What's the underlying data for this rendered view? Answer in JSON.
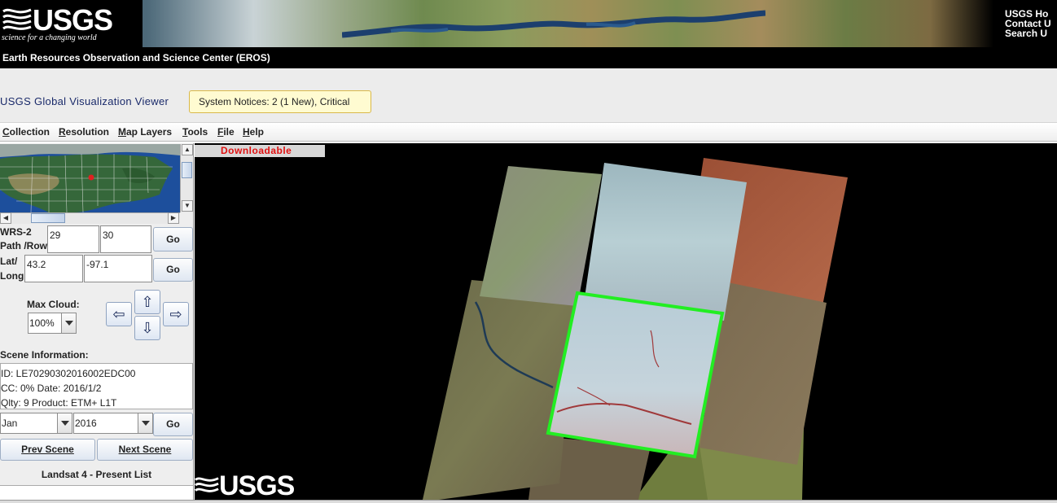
{
  "banner": {
    "logo_word": "USGS",
    "logo_tagline": "science for a changing world",
    "links": [
      "USGS Ho",
      "Contact U",
      "Search U"
    ]
  },
  "eros_bar": {
    "title": "Earth Resources Observation and Science Center (EROS)"
  },
  "header": {
    "app_title": "USGS Global Visualization Viewer",
    "system_notices": "System Notices: 2 (1 New), Critical"
  },
  "menu": {
    "items": [
      {
        "label": "Collection",
        "mnemonic": "C",
        "rest": "ollection"
      },
      {
        "label": "Resolution",
        "mnemonic": "R",
        "rest": "esolution"
      },
      {
        "label": "Map Layers",
        "mnemonic": "M",
        "rest": "ap Layers"
      },
      {
        "label": "Tools",
        "mnemonic": "T",
        "rest": "ools"
      },
      {
        "label": "File",
        "mnemonic": "F",
        "rest": "ile"
      },
      {
        "label": "Help",
        "mnemonic": "H",
        "rest": "elp"
      }
    ]
  },
  "left_panel": {
    "wrs": {
      "label_line1": "WRS-2",
      "label_line2": "Path /Row:",
      "path_value": "29",
      "row_value": "30",
      "go_label": "Go"
    },
    "latlong": {
      "label_line1": "Lat/",
      "label_line2": "Long:",
      "lat_value": "43.2",
      "long_value": "-97.1",
      "go_label": "Go"
    },
    "max_cloud": {
      "label": "Max Cloud:",
      "value": "100%"
    },
    "nav_arrows": {
      "up": "⇧",
      "down": "⇩",
      "left": "⇦",
      "right": "⇨"
    },
    "scene_info": {
      "heading": "Scene Information:",
      "id_line": "ID: LE70290302016002EDC00",
      "cc_date_line": "CC: 0%   Date: 2016/1/2",
      "qlty_product_line": "Qlty: 9  Product: ETM+ L1T"
    },
    "date_select": {
      "month": "Jan",
      "year": "2016",
      "go_label": "Go"
    },
    "prev_scene": "Prev Scene",
    "next_scene": "Next Scene",
    "list_title": "Landsat 4 - Present List"
  },
  "map_view": {
    "downloadable_label": "Downloadable",
    "watermark": "USGS"
  },
  "colors": {
    "selected_scene_outline": "#22ee22",
    "downloadable_text": "#e01010",
    "notice_bg": "#fffbd1"
  }
}
